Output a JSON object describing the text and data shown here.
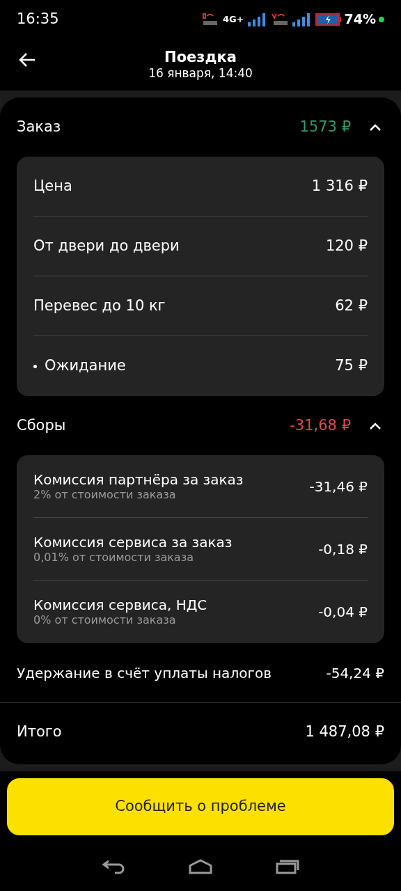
{
  "status_bar": {
    "time": "16:35",
    "network": "4G+",
    "battery": "74%"
  },
  "header": {
    "title": "Поездка",
    "subtitle": "16 января, 14:40"
  },
  "sections": [
    {
      "title": "Заказ",
      "amount": "1573 ₽",
      "color": "#2f9d68",
      "expanded": true,
      "items": [
        {
          "label": "Цена",
          "value": "1 316 ₽",
          "bullet": false
        },
        {
          "label": "От двери до двери",
          "value": "120 ₽",
          "bullet": false
        },
        {
          "label": "Перевес до 10 кг",
          "value": "62 ₽",
          "bullet": false
        },
        {
          "label": "Ожидание",
          "value": "75 ₽",
          "bullet": true
        }
      ]
    },
    {
      "title": "Сборы",
      "amount": "-31,68 ₽",
      "color": "#e0474f",
      "expanded": true,
      "items": [
        {
          "label": "Комиссия партнёра за заказ",
          "note": "2% от стоимости заказа",
          "value": "-31,46 ₽"
        },
        {
          "label": "Комиссия сервиса за заказ",
          "note": "0,01% от стоимости заказа",
          "value": "-0,18 ₽"
        },
        {
          "label": "Комиссия сервиса, НДС",
          "note": "0% от стоимости заказа",
          "value": "-0,04 ₽"
        }
      ]
    }
  ],
  "tax": {
    "label": "Удержание в счёт уплаты налогов",
    "value": "-54,24 ₽"
  },
  "total": {
    "label": "Итого",
    "value": "1 487,08 ₽"
  },
  "action_button": "Сообщить о проблеме"
}
